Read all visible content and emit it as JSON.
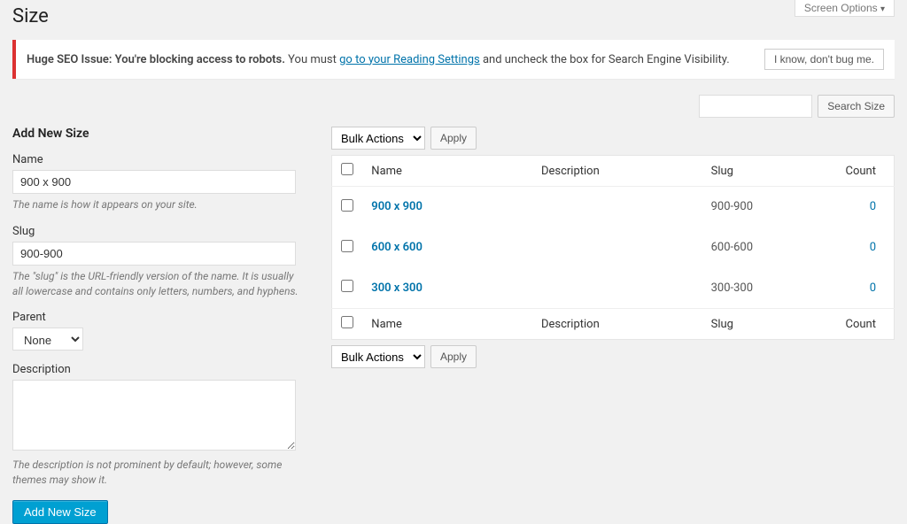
{
  "page_title": "Size",
  "screen_options_label": "Screen Options",
  "notice": {
    "strong": "Huge SEO Issue: You're blocking access to robots.",
    "before_link": " You must ",
    "link": "go to your Reading Settings",
    "after_link": " and uncheck the box for Search Engine Visibility.",
    "dismiss": "I know, don't bug me."
  },
  "search": {
    "button": "Search Size",
    "value": ""
  },
  "form": {
    "heading": "Add New Size",
    "name_label": "Name",
    "name_value": "900 x 900",
    "name_desc": "The name is how it appears on your site.",
    "slug_label": "Slug",
    "slug_value": "900-900",
    "slug_desc": "The \"slug\" is the URL-friendly version of the name. It is usually all lowercase and contains only letters, numbers, and hyphens.",
    "parent_label": "Parent",
    "parent_value": "None",
    "desc_label": "Description",
    "desc_value": "",
    "desc_desc": "The description is not prominent by default; however, some themes may show it.",
    "submit": "Add New Size"
  },
  "bulk": {
    "label": "Bulk Actions",
    "apply": "Apply"
  },
  "columns": {
    "name": "Name",
    "description": "Description",
    "slug": "Slug",
    "count": "Count"
  },
  "rows": [
    {
      "name": "900 x 900",
      "description": "",
      "slug": "900-900",
      "count": "0"
    },
    {
      "name": "600 x 600",
      "description": "",
      "slug": "600-600",
      "count": "0"
    },
    {
      "name": "300 x 300",
      "description": "",
      "slug": "300-300",
      "count": "0"
    }
  ]
}
